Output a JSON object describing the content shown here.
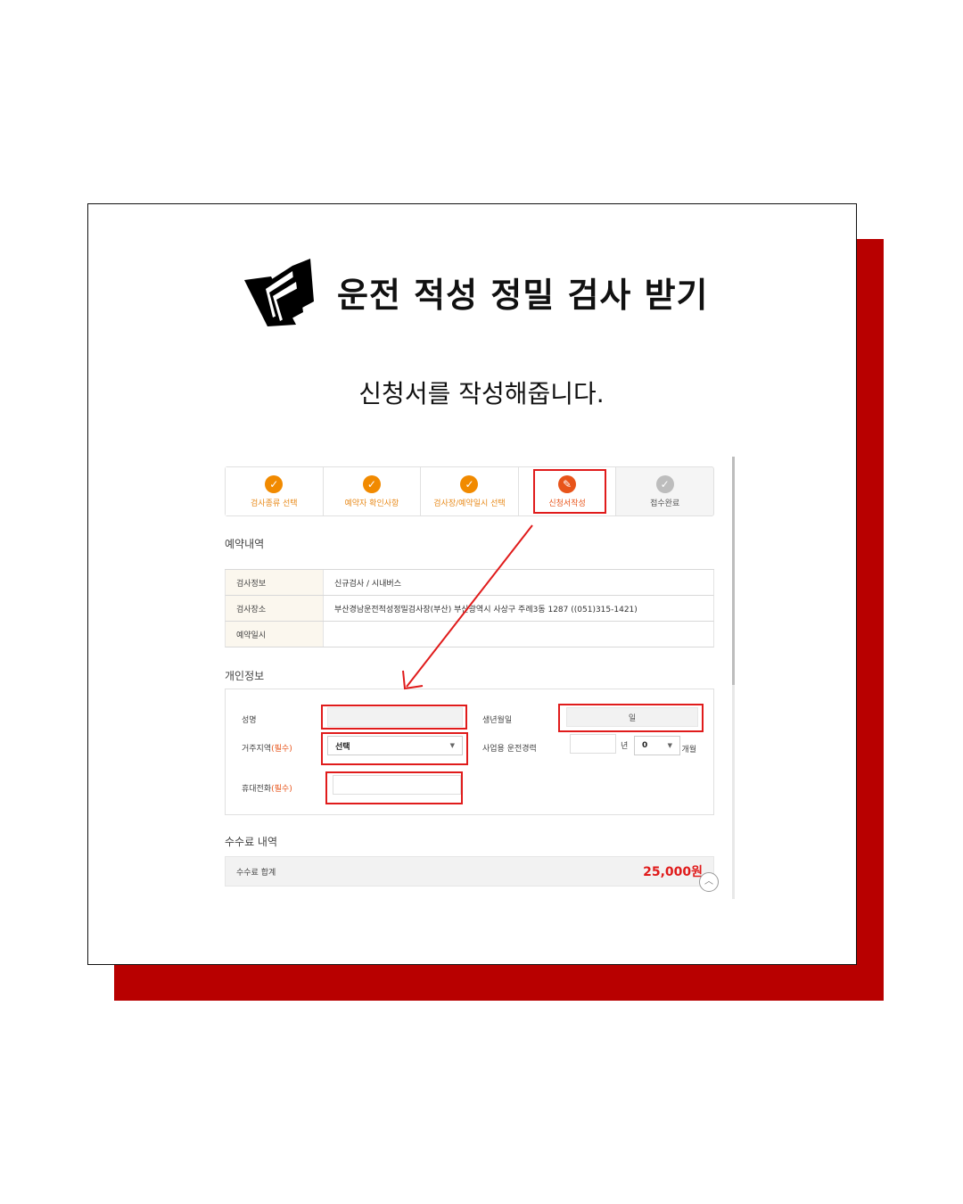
{
  "colors": {
    "accent_red": "#b80000",
    "highlight_red": "#e01b1b",
    "step_orange": "#f18a00",
    "step_current": "#e8541a"
  },
  "headline": {
    "icon": "folder-icon",
    "title": "운전 적성 정밀 검사 받기"
  },
  "subheading": "신청서를 작성해줍니다.",
  "steps": [
    {
      "label": "검사종류 선택",
      "status": "done",
      "icon": "check-icon"
    },
    {
      "label": "예약자 확인사항",
      "status": "done",
      "icon": "check-icon"
    },
    {
      "label": "검사장/예약일시 선택",
      "status": "done",
      "icon": "check-icon"
    },
    {
      "label": "신청서작성",
      "status": "current",
      "icon": "pencil-icon"
    },
    {
      "label": "접수완료",
      "status": "pending",
      "icon": "check-icon"
    }
  ],
  "reservation": {
    "title": "예약내역",
    "rows": [
      {
        "key": "검사정보",
        "value": "신규검사 / 시내버스"
      },
      {
        "key": "검사장소",
        "value": "부산경남운전적성정밀검사장(부산) 부산광역시 사상구 주례3동 1287 ((051)315-1421)"
      },
      {
        "key": "예약일시",
        "value": ""
      }
    ]
  },
  "personal": {
    "title": "개인정보",
    "name_label": "성명",
    "birth_label": "생년월일",
    "birth_value": "일",
    "region_label": "거주지역",
    "required_mark": "(필수)",
    "region_value": "선택",
    "career_label": "사업용 운전경력",
    "career_year_unit": "년",
    "career_month_value": "0",
    "career_month_unit": "개월",
    "phone_label": "휴대전화"
  },
  "fees": {
    "title": "수수료 내역",
    "total_label": "수수료 합계",
    "total_value": "25,000원"
  }
}
